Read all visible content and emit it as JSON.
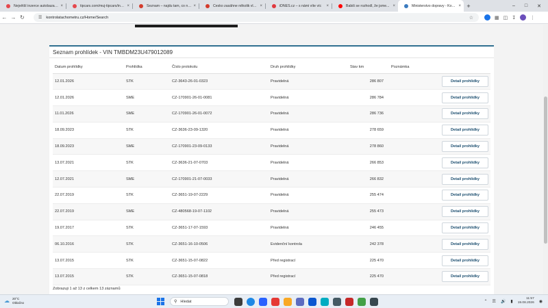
{
  "browser": {
    "tabs": [
      {
        "title": "Největší inzerce autobazarů - T...",
        "color": "#e5484d",
        "active": false
      },
      {
        "title": "tipcars.com/muj-tipcars/inzer...",
        "color": "#e5484d",
        "active": false
      },
      {
        "title": "Seznam – najdu tam, co nezná...",
        "color": "#d33b2c",
        "active": false
      },
      {
        "title": "Česko zasáhne několik vln ořej...",
        "color": "#d33b2c",
        "active": false
      },
      {
        "title": "iDNES.cz – s námi víte víc",
        "color": "#e0393e",
        "active": false
      },
      {
        "title": "Babiš se rozhodl, že jsme...",
        "color": "#ff0000",
        "active": false
      },
      {
        "title": "Ministerstvo dopravy - Kontro...",
        "color": "#3b7bbf",
        "active": true
      }
    ],
    "new_tab_glyph": "+",
    "url": "kontrolatachometru.cz/Home/Search"
  },
  "panel": {
    "title": "Seznam prohlídek - VIN TMBDM23U479012089",
    "columns": [
      "Datum prohlídky",
      "Prohlídka",
      "Číslo protokolu",
      "Druh prohlídky",
      "Stav km",
      "Poznámka"
    ],
    "button_label": "Detail prohlídky",
    "rows": [
      {
        "date": "12.01.2026",
        "type": "STK",
        "protocol": "CZ-3643-26-01-0323",
        "kind": "Pravidelná",
        "km": "286 807",
        "note": ""
      },
      {
        "date": "12.01.2026",
        "type": "SME",
        "protocol": "CZ-170901-26-01-0081",
        "kind": "Pravidelná",
        "km": "286 784",
        "note": ""
      },
      {
        "date": "11.01.2026",
        "type": "SME",
        "protocol": "CZ-170901-26-01-0072",
        "kind": "Pravidelná",
        "km": "286 736",
        "note": ""
      },
      {
        "date": "18.09.2023",
        "type": "STK",
        "protocol": "CZ-3636-23-09-1320",
        "kind": "Pravidelná",
        "km": "278 659",
        "note": ""
      },
      {
        "date": "18.09.2023",
        "type": "SME",
        "protocol": "CZ-170901-23-09-0133",
        "kind": "Pravidelná",
        "km": "278 860",
        "note": ""
      },
      {
        "date": "13.07.2021",
        "type": "STK",
        "protocol": "CZ-3636-21-07-0703",
        "kind": "Pravidelná",
        "km": "266 853",
        "note": ""
      },
      {
        "date": "12.07.2021",
        "type": "SME",
        "protocol": "CZ-170901-21-07-0033",
        "kind": "Pravidelná",
        "km": "266 832",
        "note": ""
      },
      {
        "date": "22.07.2019",
        "type": "STK",
        "protocol": "CZ-3651-19-07-2229",
        "kind": "Pravidelná",
        "km": "255 474",
        "note": ""
      },
      {
        "date": "22.07.2019",
        "type": "SME",
        "protocol": "CZ-480568-19-07-1102",
        "kind": "Pravidelná",
        "km": "255 473",
        "note": ""
      },
      {
        "date": "19.07.2017",
        "type": "STK",
        "protocol": "CZ-3651-17-07-1593",
        "kind": "Pravidelná",
        "km": "246 455",
        "note": ""
      },
      {
        "date": "06.10.2016",
        "type": "STK",
        "protocol": "CZ-3651-16-10-0506",
        "kind": "Evidenční kontrola",
        "km": "242 378",
        "note": ""
      },
      {
        "date": "13.07.2015",
        "type": "STK",
        "protocol": "CZ-3651-15-07-0822",
        "kind": "Před registrací",
        "km": "225 470",
        "note": ""
      },
      {
        "date": "13.07.2015",
        "type": "STK",
        "protocol": "CZ-3651-15-07-0818",
        "kind": "Před registrací",
        "km": "225 470",
        "note": ""
      }
    ],
    "summary": "Zobrazuji 1 až 13 z celkem 13 záznamů"
  },
  "taskbar": {
    "weather_temp": "20°C",
    "weather_desc": "Oblačno",
    "search_placeholder": "Hledat",
    "time": "11:57",
    "date": "19.08.2026"
  },
  "colors": {
    "accent": "#2f6f8f",
    "button_text": "#1d4f70"
  }
}
